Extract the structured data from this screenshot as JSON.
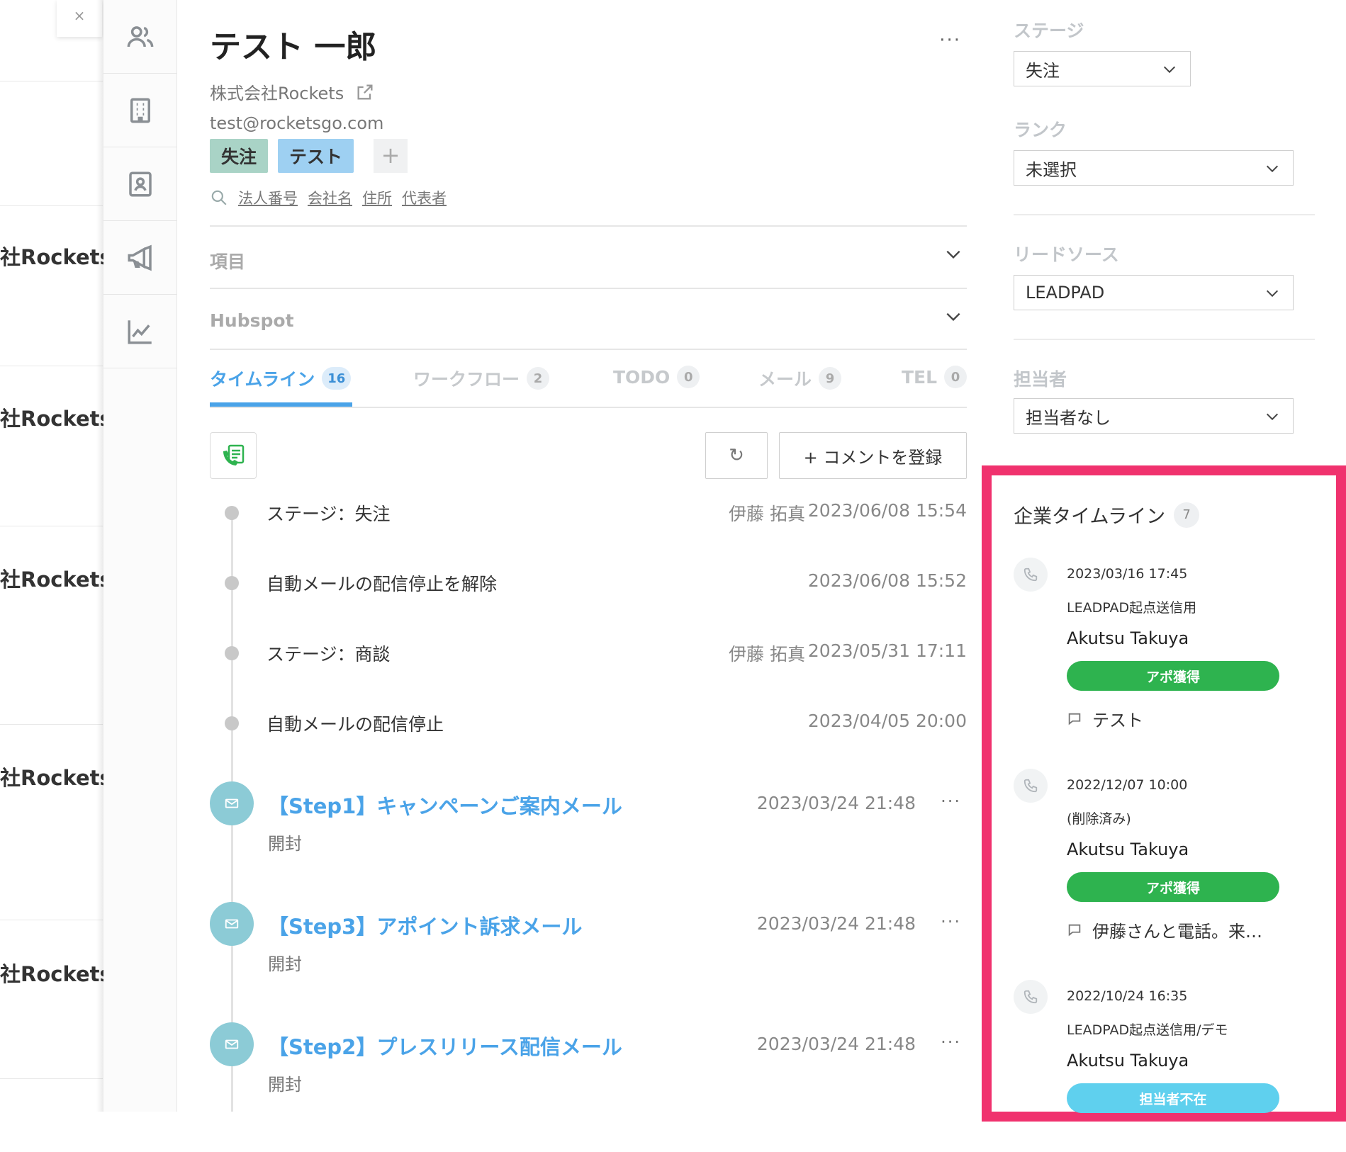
{
  "list": {
    "close_label": "×",
    "rows": [
      "社Rockets",
      "社Rockets",
      "社Rockets",
      "社Rockets",
      "社Rockets"
    ]
  },
  "rail": {
    "icons": [
      "users-icon",
      "building-icon",
      "contact-card-icon",
      "megaphone-icon",
      "chart-icon"
    ]
  },
  "contact": {
    "name": "テスト 一郎",
    "more": "···",
    "company": "株式会社Rockets",
    "email": "test@rocketsgo.com",
    "tags": [
      "失注",
      "テスト"
    ],
    "add_tag": "+",
    "search_links": [
      "法人番号",
      "会社名",
      "住所",
      "代表者"
    ]
  },
  "sections": [
    {
      "label": "項目"
    },
    {
      "label": "Hubspot"
    }
  ],
  "tabs": [
    {
      "label": "タイムライン",
      "count": "16",
      "active": true
    },
    {
      "label": "ワークフロー",
      "count": "2"
    },
    {
      "label": "TODO",
      "count": "0"
    },
    {
      "label": "メール",
      "count": "9"
    },
    {
      "label": "TEL",
      "count": "0"
    }
  ],
  "actions": {
    "refresh": "↻",
    "add_comment": "+ コメントを登録"
  },
  "timeline": [
    {
      "text": "ステージ：失注",
      "user": "伊藤 拓真",
      "date": "2023/06/08 15:54"
    },
    {
      "text": "自動メールの配信停止を解除",
      "user": "",
      "date": "2023/06/08 15:52"
    },
    {
      "text": "ステージ：商談",
      "user": "伊藤 拓真",
      "date": "2023/05/31 17:11"
    },
    {
      "text": "自動メールの配信停止",
      "user": "",
      "date": "2023/04/05 20:00"
    }
  ],
  "mails": [
    {
      "title": "【Step1】キャンペーンご案内メール",
      "date": "2023/03/24 21:48",
      "status": "開封",
      "more": "···"
    },
    {
      "title": "【Step3】アポイント訴求メール",
      "date": "2023/03/24 21:48",
      "status": "開封",
      "more": "···"
    },
    {
      "title": "【Step2】プレスリリース配信メール",
      "date": "2023/03/24 21:48",
      "status": "開封",
      "more": "···"
    }
  ],
  "right": {
    "stage_label": "ステージ",
    "stage_value": "失注",
    "rank_label": "ランク",
    "rank_value": "未選択",
    "lead_label": "リードソース",
    "lead_value": "LEADPAD",
    "owner_label": "担当者",
    "owner_value": "担当者なし"
  },
  "company_timeline": {
    "title": "企業タイムライン",
    "count": "7",
    "accent": "#f0326e",
    "entries": [
      {
        "datetime": "2023/03/16 17:45",
        "source": "LEADPAD起点送信用",
        "person": "Akutsu Takuya",
        "badge": "アポ獲得",
        "badge_color": "#2eb34f",
        "comment": "テスト"
      },
      {
        "datetime": "2022/12/07 10:00",
        "source": "(削除済み)",
        "person": "Akutsu Takuya",
        "badge": "アポ獲得",
        "badge_color": "#2eb34f",
        "comment": "伊藤さんと電話。来…"
      },
      {
        "datetime": "2022/10/24 16:35",
        "source": "LEADPAD起点送信用/デモ",
        "person": "Akutsu Takuya",
        "badge": "担当者不在",
        "badge_color": "#5fd0ee"
      }
    ]
  }
}
